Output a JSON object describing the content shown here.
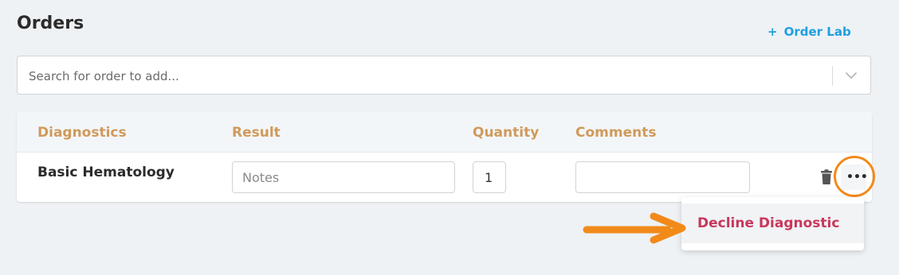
{
  "header": {
    "title": "Orders",
    "order_lab_plus": "+",
    "order_lab_label": "Order Lab"
  },
  "search": {
    "placeholder": "Search for order to add...",
    "value": ""
  },
  "table": {
    "columns": [
      "Diagnostics",
      "Result",
      "Quantity",
      "Comments"
    ],
    "rows": [
      {
        "name": "Basic Hematology",
        "result_placeholder": "Notes",
        "result_value": "",
        "quantity": "1",
        "comments": ""
      }
    ]
  },
  "row_actions": {
    "more_label": "•••"
  },
  "dropdown": {
    "items": [
      {
        "label": "Decline Diagnostic"
      }
    ]
  },
  "colors": {
    "accent_blue": "#1f9fe0",
    "header_text": "#d09a5b",
    "decline_text": "#c8385c",
    "highlight_orange": "#f28a1a"
  },
  "icons": [
    "chevron-down-icon",
    "trash-icon",
    "more-horizontal-icon",
    "arrow-right-icon"
  ]
}
